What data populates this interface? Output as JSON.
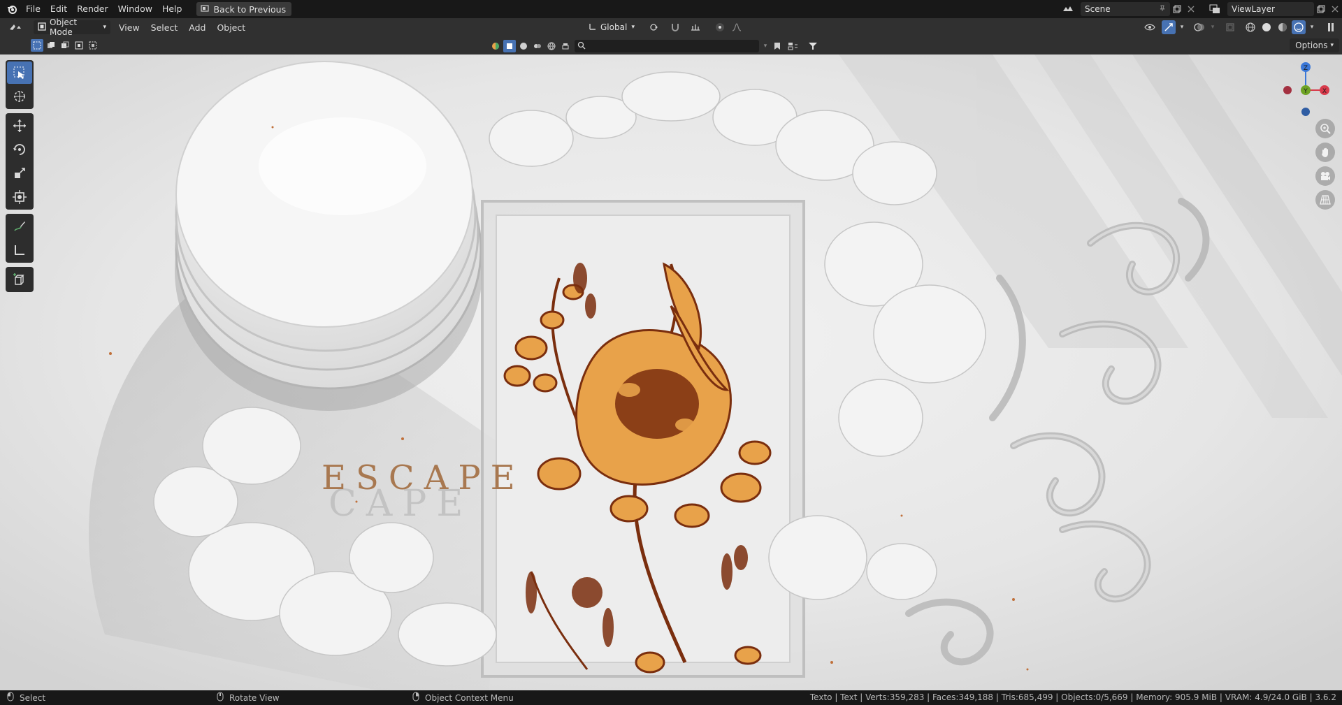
{
  "topbar": {
    "menus": [
      "File",
      "Edit",
      "Render",
      "Window",
      "Help"
    ],
    "back_label": "Back to Previous",
    "scene": "Scene",
    "view_layer": "ViewLayer"
  },
  "header": {
    "mode": "Object Mode",
    "menus": [
      "View",
      "Select",
      "Add",
      "Object"
    ],
    "transform_orientation": "Global"
  },
  "tool_settings": {
    "options_label": "Options"
  },
  "viewport": {
    "scene_text": "ESCAPE"
  },
  "gizmo": {
    "z_label": "Z",
    "x_label": "X",
    "y_label": "Y"
  },
  "status": {
    "hint1": "Select",
    "hint2": "Rotate View",
    "hint3": "Object Context Menu",
    "stats": "Texto | Text | Verts:359,283 | Faces:349,188 | Tris:685,499 | Objects:0/5,669 | Memory: 905.9 MiB | VRAM: 4.9/24.0 GiB | 3.6.2"
  },
  "colors": {
    "accent": "#4772b3",
    "flower_orange": "#e8a24a",
    "flower_dark": "#7a2e0e",
    "axis_x": "#d83a4b",
    "axis_y": "#6ea324",
    "axis_z": "#3b78d8"
  }
}
